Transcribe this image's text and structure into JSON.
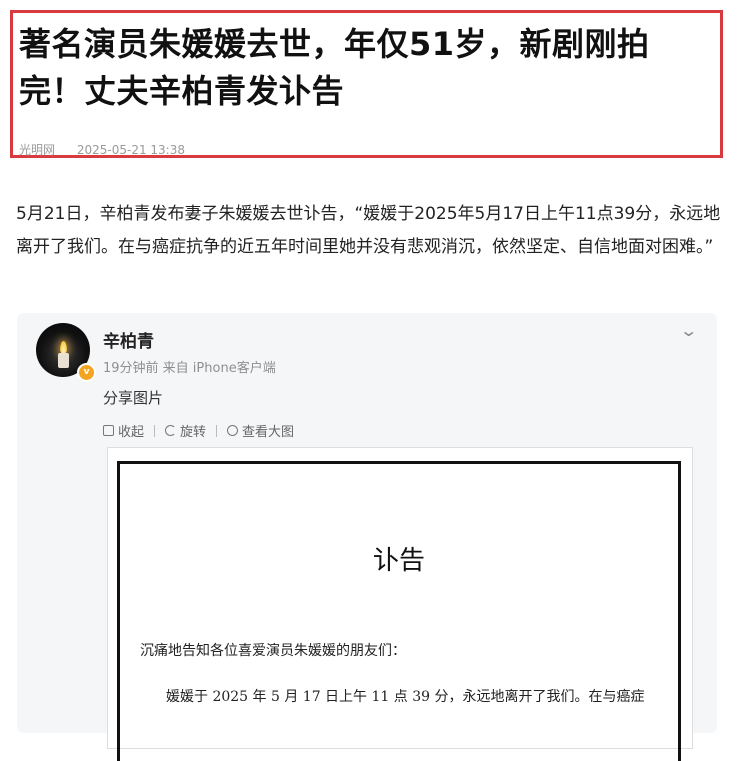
{
  "headline": {
    "title": "著名演员朱媛媛去世，年仅51岁，新剧刚拍完！丈夫辛柏青发讣告",
    "source": "光明网",
    "datetime": "2025-05-21 13:38"
  },
  "article": {
    "paragraph": "5月21日，辛柏青发布妻子朱媛媛去世讣告，“媛媛于2025年5月17日上午11点39分，永远地离开了我们。在与癌症抗争的近五年时间里她并没有悲观消沉，依然坚定、自信地面对困难。”"
  },
  "weibo": {
    "username": "辛柏青",
    "meta": "19分钟前 来自 iPhone客户端",
    "post_text": "分享图片",
    "verified_badge": "v",
    "toolbar": {
      "collect": "收起",
      "rotate": "旋转",
      "view_large": "查看大图"
    },
    "notice": {
      "title": "讣告",
      "line1": "沉痛地告知各位喜爱演员朱媛媛的朋友们：",
      "line2": "媛媛于 2025 年 5 月 17 日上午 11 点 39 分，永远地离开了我们。在与癌症"
    }
  },
  "icons": {
    "expand": "chevron-down-icon",
    "collect": "collapse-icon",
    "rotate": "rotate-icon",
    "view": "zoom-icon"
  },
  "colors": {
    "highlight_border": "#d83a3f",
    "card_background": "#f5f6f8",
    "badge": "#f3a521"
  }
}
